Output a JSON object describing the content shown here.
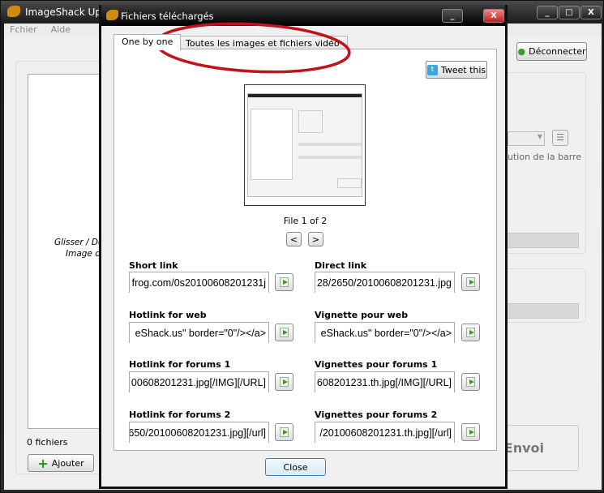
{
  "main_window": {
    "title": "ImageShack Uploader",
    "menu": [
      "Fchier",
      "Aide"
    ],
    "drop_text": [
      "Glisser / Dép",
      "Image o"
    ],
    "file_count": "0 fichiers",
    "add_button": "Ajouter",
    "logout_button": "Déconnecter",
    "bar_text": "ution de la barre",
    "send_button": "Envoi"
  },
  "dialog": {
    "title": "Fichiers téléchargés",
    "tabs": [
      {
        "label": "One by one",
        "active": true
      },
      {
        "label": "Toutes les images et fichiers vidéo",
        "active": false
      }
    ],
    "tweet_button": "Tweet this",
    "file_indicator": "File 1 of 2",
    "prev": "<",
    "next": ">",
    "fields": [
      {
        "label": "Short link",
        "value": "frog.com/0s20100608201231j"
      },
      {
        "label": "Direct link",
        "value": "28/2650/20100608201231.jpg"
      },
      {
        "label": "Hotlink for web",
        "value": "eShack.us\" border=\"0\"/></a>"
      },
      {
        "label": "Vignette pour web",
        "value": "eShack.us\" border=\"0\"/></a>"
      },
      {
        "label": "Hotlink for forums 1",
        "value": "00608201231.jpg[/IMG][/URL]"
      },
      {
        "label": "Vignettes pour forums 1",
        "value": "608201231.th.jpg[/IMG][/URL]"
      },
      {
        "label": "Hotlink for forums 2",
        "value": "650/20100608201231.jpg][/url]"
      },
      {
        "label": "Vignettes pour forums 2",
        "value": "/20100608201231.th.jpg][/url]"
      }
    ],
    "close_button": "Close"
  },
  "colors": {
    "annotation_ellipse": "#c0141a",
    "copy_arrow": "#3a9a20"
  }
}
